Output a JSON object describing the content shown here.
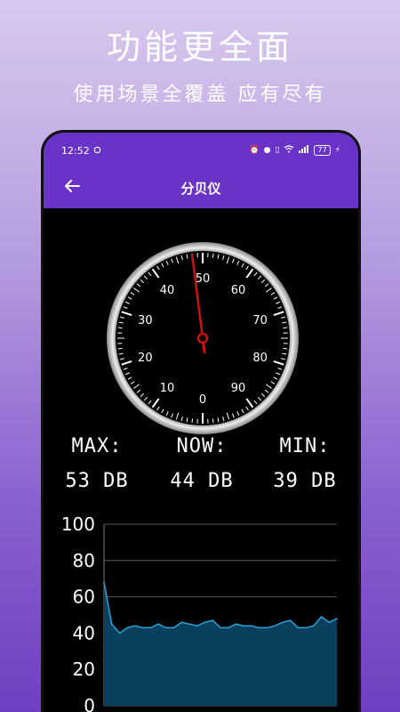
{
  "promo": {
    "title": "功能更全面",
    "subtitle": "使用场景全覆盖 应有尽有"
  },
  "status_bar": {
    "time": "12:52",
    "battery": "77"
  },
  "app_bar": {
    "title": "分贝仪"
  },
  "gauge": {
    "labels": [
      "0",
      "10",
      "20",
      "30",
      "40",
      "50",
      "60",
      "70",
      "80",
      "90"
    ],
    "needle_value": 48
  },
  "readouts": {
    "max_label": "MAX:",
    "max_value": "53 DB",
    "now_label": "NOW:",
    "now_value": "44 DB",
    "min_label": "MIN:",
    "min_value": "39 DB"
  },
  "colors": {
    "accent": "#6a33c8",
    "chart_fill": "#0b3f5e",
    "chart_line": "#2aa3d8",
    "needle": "#cc1111"
  },
  "chart_data": {
    "type": "area",
    "ylim": [
      0,
      100
    ],
    "yticks": [
      "0",
      "20",
      "40",
      "60",
      "80",
      "100"
    ],
    "values": [
      68,
      45,
      40,
      43,
      44,
      43,
      43,
      45,
      43,
      43,
      46,
      45,
      44,
      46,
      47,
      43,
      43,
      45,
      44,
      44,
      43,
      43,
      44,
      46,
      47,
      43,
      43,
      44,
      49,
      46,
      48
    ]
  }
}
